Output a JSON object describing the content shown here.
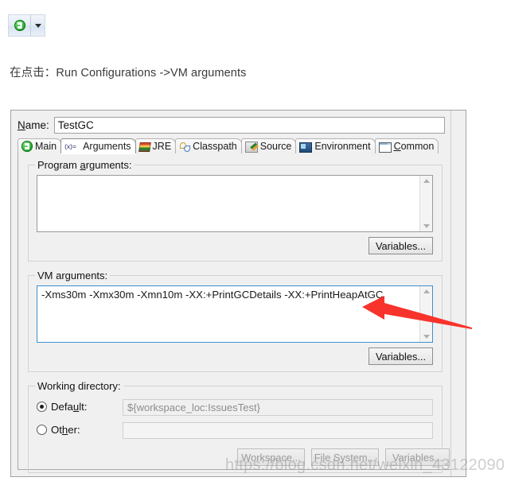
{
  "toolbar": {
    "run_button_title": "Run",
    "run_icon": "green-play-circle-icon",
    "dropdown_icon": "caret-down-icon"
  },
  "caption": {
    "text": "在点击：Run Configurations ->VM arguments"
  },
  "dialog": {
    "name_field": {
      "label_prefix": "N",
      "label_rest": "ame:",
      "value": "TestGC"
    },
    "tabs": [
      {
        "label": "Main",
        "icon": "green-run-circle-icon",
        "active": false
      },
      {
        "label": "Arguments",
        "icon": "variable-xequals-icon",
        "active": true
      },
      {
        "label": "JRE",
        "icon": "books-stack-icon",
        "active": false
      },
      {
        "label": "Classpath",
        "icon": "two-links-icon",
        "active": false
      },
      {
        "label": "Source",
        "icon": "document-pencil-icon",
        "active": false
      },
      {
        "label": "Environment",
        "icon": "monitor-window-icon",
        "active": false
      },
      {
        "label": "Common",
        "icon": "window-layout-icon",
        "active": false
      }
    ],
    "args_tab_icon_text": "(x)=",
    "program_arguments": {
      "group_label_a": "Program ",
      "group_label_mn": "a",
      "group_label_b": "rguments:",
      "value": "",
      "variables_button": "Variables..."
    },
    "vm_arguments": {
      "group_label_a": "VM ar",
      "group_label_mn": "g",
      "group_label_b": "uments:",
      "value": "-Xms30m -Xmx30m -Xmn10m -XX:+PrintGCDetails -XX:+PrintHeapAtGC",
      "variables_button": "Variables..."
    },
    "working_directory": {
      "group_label": "Working directory:",
      "default_radio": {
        "label_a": "Defa",
        "label_mn": "u",
        "label_b": "lt:",
        "checked": true,
        "value": "${workspace_loc:IssuesTest}"
      },
      "other_radio": {
        "label_a": "Ot",
        "label_mn": "h",
        "label_b": "er:",
        "checked": false,
        "value": ""
      },
      "buttons": [
        {
          "label": "Workspace...",
          "disabled": true
        },
        {
          "label": "File System...",
          "disabled": true
        },
        {
          "label": "Variables...",
          "disabled": true
        }
      ]
    }
  },
  "annotation": {
    "arrow_color": "#f8332b",
    "arrow_direction": "left"
  },
  "watermark": {
    "text": "https://blog.csdn.net/weixin_43122090"
  }
}
